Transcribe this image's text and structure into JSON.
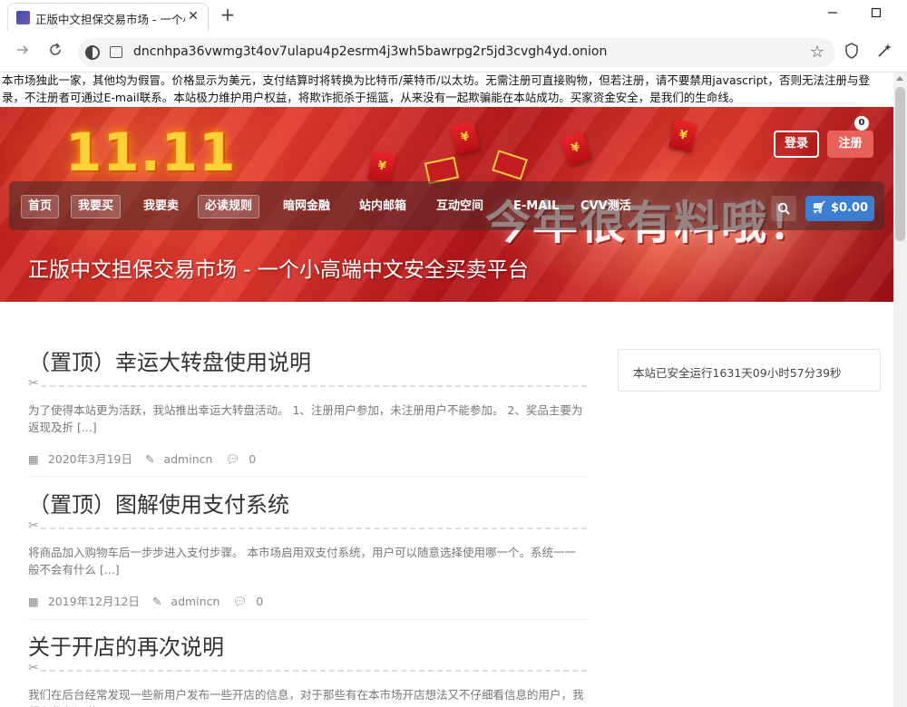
{
  "browser": {
    "tab_title": "正版中文担保交易市场 - 一个小高端中文安全买卖平台",
    "tab_close": "✕",
    "new_tab": "+",
    "url": "dncnhpa36vwmg3t4ov7ulapu4p2esrm4j3wh5bawrpg2r5jd3cvgh4yd.onion"
  },
  "notice": "本市场独此一家，其他均为假冒。价格显示为美元，支付结算时将转换为比特币/莱特币/以太坊。无需注册可直接购物，但若注册，请不要禁用javascript，否则无法注册与登录，不注册者可通过E-mail联系。本站极力维护用户权益，将欺诈扼杀于摇篮，从来没有一起欺骗能在本站成功。买家资金安全，是我们的生命线。",
  "banner": {
    "big_text": "11.11",
    "slogan": "今年很有料哦！",
    "login": "登录",
    "register": "注册",
    "site_title": "正版中文担保交易市场 - 一个小高端中文安全买卖平台"
  },
  "menu": {
    "items": [
      "首页",
      "我要买",
      "我要卖",
      "必读规则",
      "暗网金融",
      "站内邮箱",
      "互动空间",
      "E-MAIL",
      "CVV测活"
    ],
    "cart_total": "$0.00",
    "cart_count": "0"
  },
  "posts": [
    {
      "title": "（置顶）幸运大转盘使用说明",
      "excerpt": "为了使得本站更为活跃，我站推出幸运大转盘活动。 1、注册用户参加，未注册用户不能参加。 2、奖品主要为返现及折 [...]",
      "date": "2020年3月19日",
      "author": "admincn",
      "comments": "0"
    },
    {
      "title": "（置顶）图解使用支付系统",
      "excerpt": "将商品加入购物车后一步步进入支付步骤。 本市场启用双支付系统，用户可以随意选择使用哪一个。系统一一般不会有什么 [...]",
      "date": "2019年12月12日",
      "author": "admincn",
      "comments": "0"
    },
    {
      "title": "关于开店的再次说明",
      "excerpt": "我们在后台经常发现一些新用户发布一些开店的信息，对于那些有在本市场开店想法又不仔细看信息的用户，我们在此在记说 [...]"
    }
  ],
  "sidebar": {
    "uptime": "本站已安全运行1631天09小时57分39秒"
  },
  "colors": {
    "cart_button": "#3d7ed3",
    "register_button": "#e8605a",
    "banner_red": "#c01d1a"
  }
}
